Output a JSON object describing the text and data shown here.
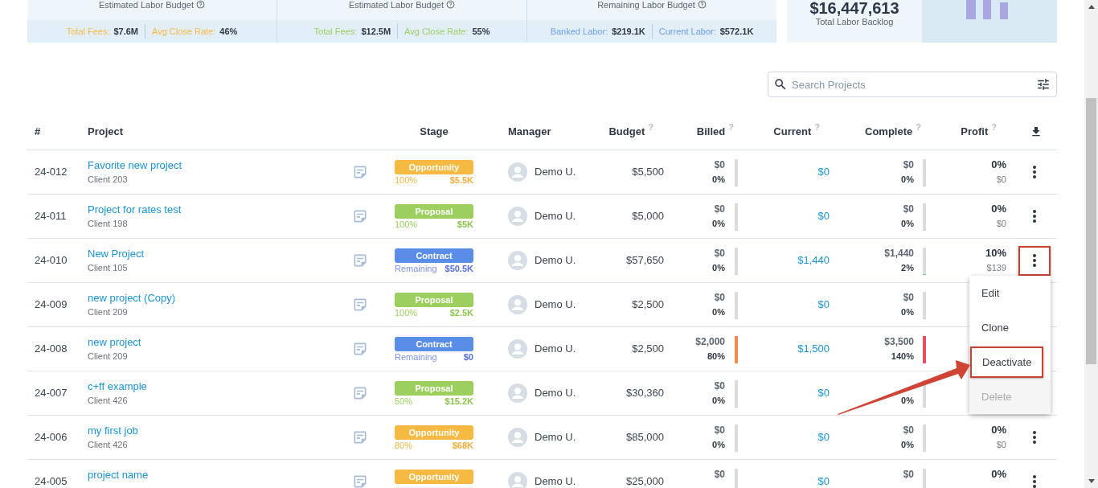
{
  "summary_panels": [
    {
      "title": "Estimated Labor Budget",
      "color": "#f5b945",
      "stats": [
        {
          "label": "Total Fees:",
          "value": "$7.6M"
        },
        {
          "label": "Avg Close Rate:",
          "value": "46%"
        }
      ]
    },
    {
      "title": "Estimated Labor Budget",
      "color": "#9fcd63",
      "stats": [
        {
          "label": "Total Fees:",
          "value": "$12.5M"
        },
        {
          "label": "Avg Close Rate:",
          "value": "55%"
        }
      ]
    },
    {
      "title": "Remaining Labor Budget",
      "color": "#6d9cea",
      "stats": [
        {
          "label": "Banked Labor:",
          "value": "$219.1K"
        },
        {
          "label": "Current Labor:",
          "value": "$572.1K"
        }
      ]
    }
  ],
  "backlog": {
    "amount": "$16,447,613",
    "label": "Total Labor Backlog"
  },
  "search": {
    "placeholder": "Search Projects"
  },
  "table": {
    "columns": [
      {
        "kind": "text",
        "label": "#"
      },
      {
        "kind": "text",
        "label": "Project"
      },
      {
        "kind": "text",
        "label": "Stage"
      },
      {
        "kind": "text",
        "label": "Manager"
      },
      {
        "kind": "text",
        "label": "Budget",
        "hint": "?"
      },
      {
        "kind": "text",
        "label": "Billed",
        "hint": "?"
      },
      {
        "kind": "text",
        "label": "Current",
        "hint": "?"
      },
      {
        "kind": "text",
        "label": "Complete",
        "hint": "?"
      },
      {
        "kind": "text",
        "label": "Profit",
        "hint": "?"
      },
      {
        "kind": "download"
      }
    ],
    "rows": [
      {
        "id": "24-012",
        "name": "Favorite new project",
        "client": "Client 203",
        "stage": {
          "kind": "opportunity",
          "label": "Opportunity",
          "note": "100%",
          "amount": "$5.5K"
        },
        "manager": "Demo U.",
        "budget": "$5,500",
        "billed": {
          "amount": "$0",
          "percent": "0%",
          "level": 0
        },
        "current": "$0",
        "complete": {
          "amount": "$0",
          "percent": "0%",
          "level": 0
        },
        "profit": {
          "percent": "0%",
          "amount": "$0"
        },
        "menu_button": {
          "highlighted": false
        }
      },
      {
        "id": "24-011",
        "name": "Project for rates test",
        "client": "Client 198",
        "stage": {
          "kind": "proposal",
          "label": "Proposal",
          "note": "100%",
          "amount": "$5K"
        },
        "manager": "Demo U.",
        "budget": "$5,000",
        "billed": {
          "amount": "$0",
          "percent": "0%",
          "level": 0
        },
        "current": "$0",
        "complete": {
          "amount": "$0",
          "percent": "0%",
          "level": 0
        },
        "profit": {
          "percent": "0%",
          "amount": "$0"
        },
        "menu_button": {
          "highlighted": false
        }
      },
      {
        "id": "24-010",
        "name": "New Project",
        "client": "Client 105",
        "stage": {
          "kind": "contract",
          "label": "Contract",
          "note": "Remaining",
          "amount": "$50.5K"
        },
        "manager": "Demo U.",
        "budget": "$57,650",
        "billed": {
          "amount": "$0",
          "percent": "0%",
          "level": 0
        },
        "current": "$1,440",
        "complete": {
          "amount": "$1,440",
          "percent": "2%",
          "level": 0.02,
          "color": "#7ccf9a"
        },
        "profit": {
          "percent": "10%",
          "amount": "$139"
        },
        "menu_button": {
          "highlighted": true
        },
        "menu": {
          "callout_arrow": true,
          "items": [
            {
              "label": "Edit",
              "highlighted": false,
              "disabled": false
            },
            {
              "label": "Clone",
              "highlighted": false,
              "disabled": false
            },
            {
              "label": "Deactivate",
              "highlighted": true,
              "disabled": false
            },
            {
              "label": "Delete",
              "highlighted": false,
              "disabled": true
            }
          ]
        }
      },
      {
        "id": "24-009",
        "name": "new project (Copy)",
        "client": "Client 209",
        "stage": {
          "kind": "proposal",
          "label": "Proposal",
          "note": "100%",
          "amount": "$2.5K"
        },
        "manager": "Demo U.",
        "budget": "$2,500",
        "billed": {
          "amount": "$0",
          "percent": "0%",
          "level": 0
        },
        "current": "$0",
        "complete": {
          "amount": "$0",
          "percent": "0%",
          "level": 0
        }
      },
      {
        "id": "24-008",
        "name": "new project",
        "client": "Client 209",
        "stage": {
          "kind": "contract",
          "label": "Contract",
          "note": "Remaining",
          "amount": "$0"
        },
        "manager": "Demo U.",
        "budget": "$2,500",
        "billed": {
          "amount": "$2,000",
          "percent": "80%",
          "level": 1,
          "color": "#f28b4b"
        },
        "current": "$1,500",
        "complete": {
          "amount": "$3,500",
          "percent": "140%",
          "level": 1,
          "color": "#ec4d5e"
        }
      },
      {
        "id": "24-007",
        "name": "c+ff example",
        "client": "Client 426",
        "stage": {
          "kind": "proposal",
          "label": "Proposal",
          "note": "50%",
          "amount": "$15.2K"
        },
        "manager": "Demo U.",
        "budget": "$30,360",
        "billed": {
          "amount": "$0",
          "percent": "0%",
          "level": 0
        },
        "current": "$0",
        "complete": {
          "percent": "0%",
          "level": 0
        }
      },
      {
        "id": "24-006",
        "name": "my first job",
        "client": "Client 426",
        "stage": {
          "kind": "opportunity",
          "label": "Opportunity",
          "note": "80%",
          "amount": "$68K"
        },
        "manager": "Demo U.",
        "budget": "$85,000",
        "billed": {
          "amount": "$0",
          "percent": "0%",
          "level": 0
        },
        "current": "$0",
        "complete": {
          "amount": "$0",
          "percent": "0%",
          "level": 0
        },
        "profit": {
          "percent": "0%",
          "amount": "$0"
        },
        "menu_button": {
          "highlighted": false
        }
      },
      {
        "id": "24-005",
        "name": "project name",
        "stage": {
          "kind": "opportunity",
          "label": "Opportunity"
        },
        "manager": "Demo U.",
        "budget": "$25,000",
        "billed": {
          "amount": "$0"
        },
        "current": "$0",
        "complete": {
          "amount": "$0"
        },
        "profit": {
          "percent": "0%"
        },
        "menu_button": {
          "highlighted": false
        }
      }
    ]
  }
}
